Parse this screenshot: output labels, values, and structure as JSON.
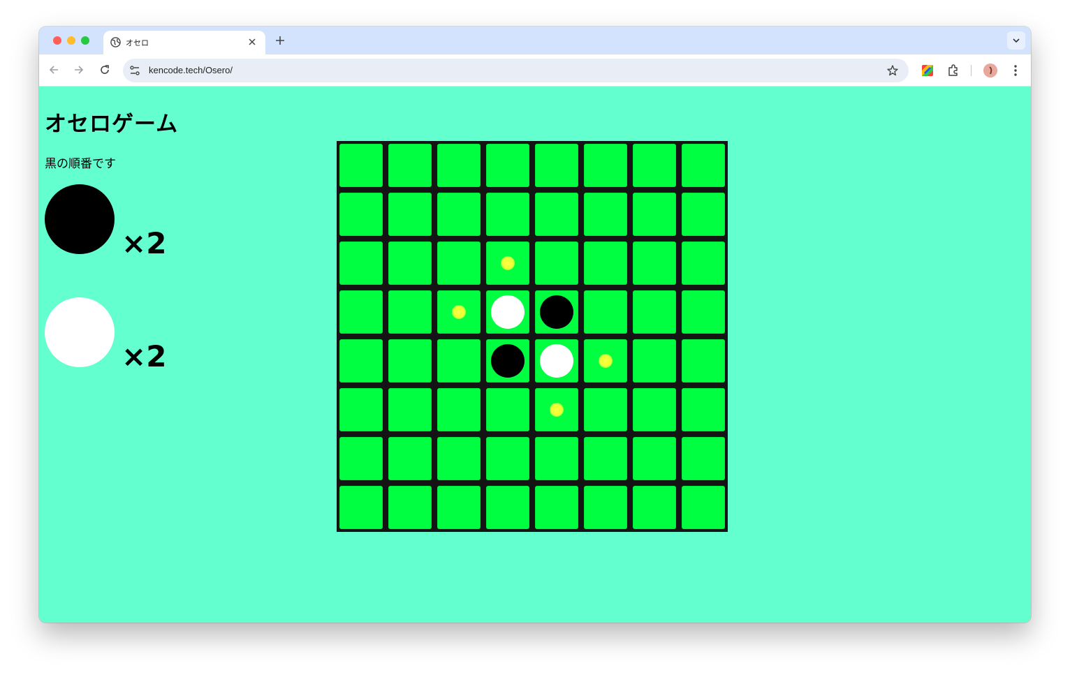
{
  "browser": {
    "tab_title": "オセロ",
    "url": "kencode.tech/Osero/"
  },
  "page": {
    "title": "オセロゲーム",
    "turn_text": "黒の順番です",
    "black_count": "×2",
    "white_count": "×2"
  },
  "colors": {
    "page_background": "#63ffcf",
    "board_border": "#141414",
    "cell": "#00ff41",
    "hint": "#f0ff3a"
  },
  "board": {
    "size": 8,
    "legend": {
      "0": "empty",
      "1": "black",
      "2": "white",
      "3": "legal-move-hint"
    },
    "rows": [
      [
        0,
        0,
        0,
        0,
        0,
        0,
        0,
        0
      ],
      [
        0,
        0,
        0,
        0,
        0,
        0,
        0,
        0
      ],
      [
        0,
        0,
        0,
        3,
        0,
        0,
        0,
        0
      ],
      [
        0,
        0,
        3,
        2,
        1,
        0,
        0,
        0
      ],
      [
        0,
        0,
        0,
        1,
        2,
        3,
        0,
        0
      ],
      [
        0,
        0,
        0,
        0,
        3,
        0,
        0,
        0
      ],
      [
        0,
        0,
        0,
        0,
        0,
        0,
        0,
        0
      ],
      [
        0,
        0,
        0,
        0,
        0,
        0,
        0,
        0
      ]
    ]
  }
}
